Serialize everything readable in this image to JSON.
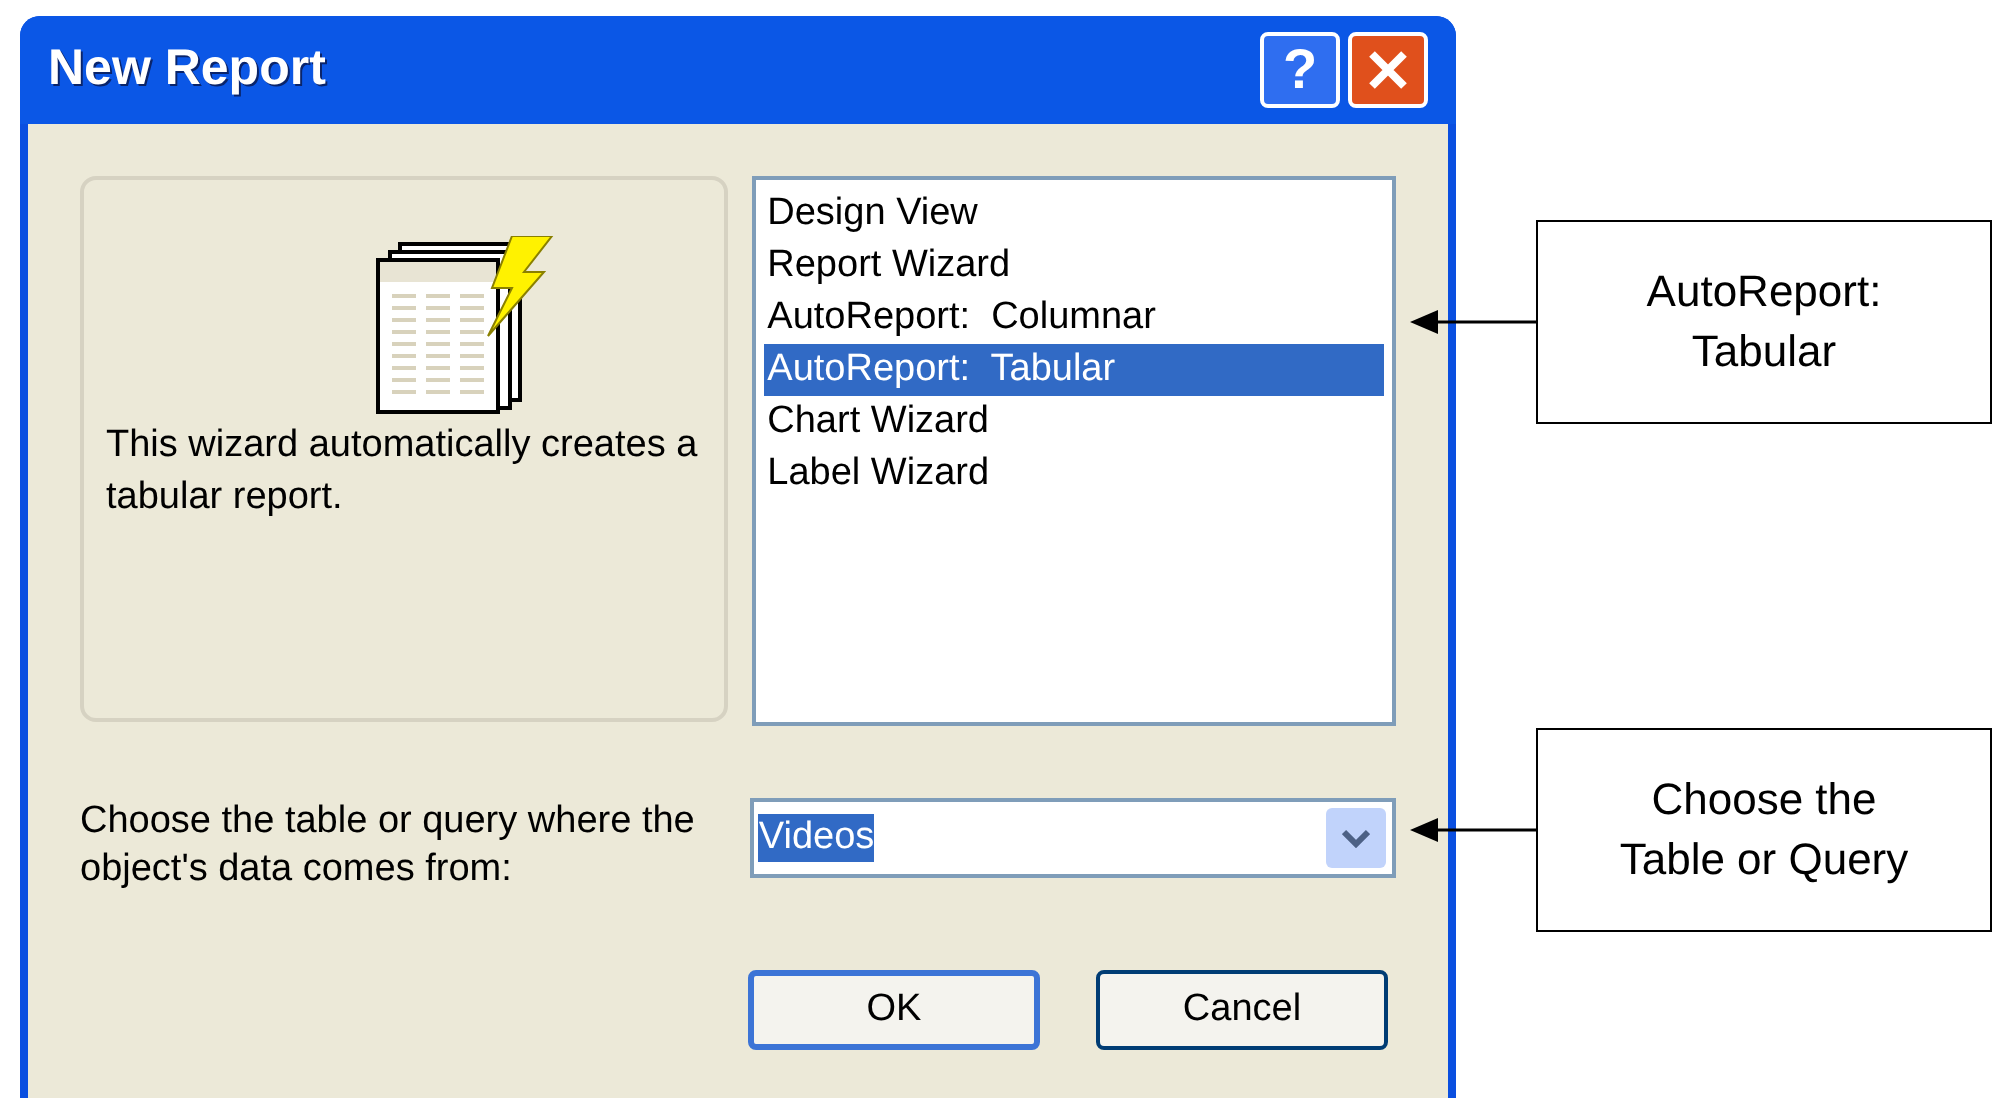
{
  "dialog": {
    "title": "New Report",
    "help_label": "?",
    "description": "This wizard automatically creates a tabular report.",
    "report_types": [
      {
        "label": "Design View",
        "selected": false
      },
      {
        "label": "Report Wizard",
        "selected": false
      },
      {
        "label": "AutoReport:  Columnar",
        "selected": false
      },
      {
        "label": "AutoReport:  Tabular",
        "selected": true
      },
      {
        "label": "Chart Wizard",
        "selected": false
      },
      {
        "label": "Label Wizard",
        "selected": false
      }
    ],
    "source_label": "Choose the table or query where the object's data comes from:",
    "source_value": "Videos",
    "buttons": [
      {
        "label": "OK",
        "default": true
      },
      {
        "label": "Cancel",
        "default": false
      }
    ]
  },
  "callouts": [
    {
      "lines": [
        "AutoReport:",
        "Tabular"
      ]
    },
    {
      "lines": [
        "Choose the",
        "Table or Query"
      ]
    }
  ]
}
